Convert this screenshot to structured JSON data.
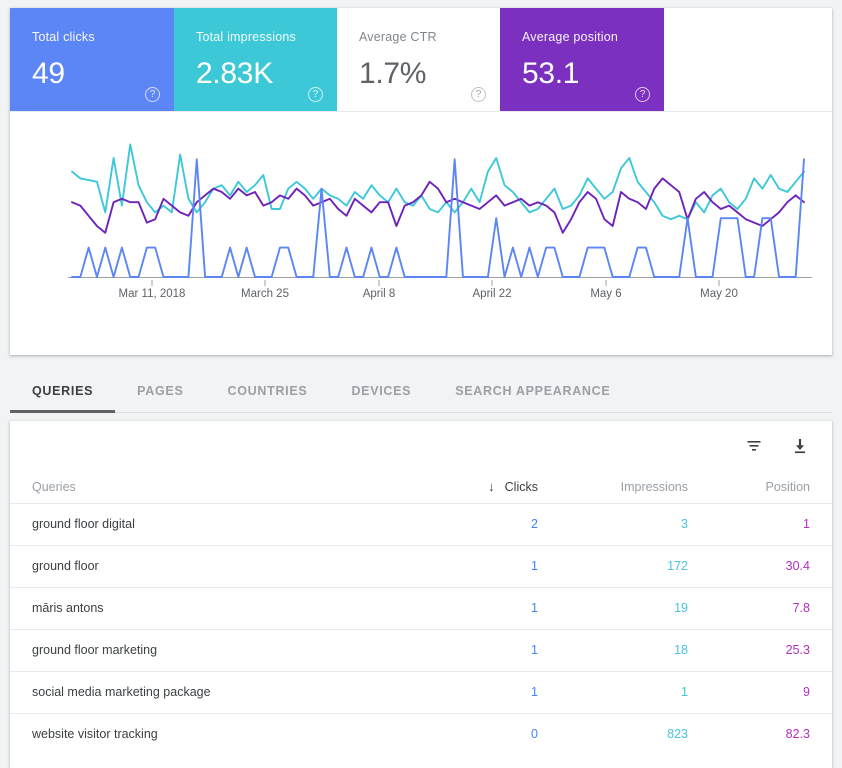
{
  "metrics": [
    {
      "label": "Total clicks",
      "value": "49",
      "key": "clicks",
      "color": "#5c85f5",
      "help": "?"
    },
    {
      "label": "Total impressions",
      "value": "2.83K",
      "key": "impressions",
      "color": "#3dc8d8",
      "help": "?"
    },
    {
      "label": "Average CTR",
      "value": "1.7%",
      "key": "ctr",
      "color": "#ffffff",
      "help": "?"
    },
    {
      "label": "Average position",
      "value": "53.1",
      "key": "position",
      "color": "#7c30c0",
      "help": "?"
    }
  ],
  "chart_data": {
    "type": "line",
    "title": "",
    "xlabel": "",
    "ylabel": "",
    "grid": false,
    "legend": "none",
    "x_tick_labels": [
      "Mar 11, 2018",
      "March 25",
      "April 8",
      "April 22",
      "May 6",
      "May 20"
    ],
    "x_tick_positions": [
      152,
      265,
      379,
      492,
      606,
      719
    ],
    "series": [
      {
        "name": "Clicks",
        "color": "#5c85f5",
        "values": [
          0,
          0,
          1,
          0,
          1,
          0,
          1,
          0,
          0,
          1,
          1,
          0,
          0,
          0,
          0,
          4,
          0,
          0,
          0,
          1,
          0,
          1,
          0,
          0,
          0,
          1,
          1,
          0,
          0,
          0,
          3,
          0,
          0,
          1,
          0,
          0,
          1,
          0,
          0,
          1,
          0,
          0,
          0,
          0,
          0,
          0,
          4,
          0,
          0,
          0,
          0,
          2,
          0,
          1,
          0,
          1,
          0,
          1,
          1,
          0,
          0,
          0,
          1,
          1,
          1,
          0,
          0,
          0,
          1,
          1,
          0,
          0,
          0,
          0,
          2,
          0,
          0,
          0,
          2,
          2,
          2,
          0,
          0,
          2,
          2,
          0,
          0,
          0,
          4
        ]
      },
      {
        "name": "Impressions",
        "color": "#3dc8d8",
        "values": [
          62,
          58,
          57,
          56,
          38,
          70,
          42,
          78,
          54,
          44,
          38,
          42,
          38,
          72,
          46,
          38,
          44,
          52,
          54,
          48,
          56,
          50,
          54,
          60,
          40,
          40,
          52,
          56,
          52,
          46,
          52,
          48,
          46,
          42,
          50,
          46,
          54,
          48,
          44,
          52,
          44,
          42,
          48,
          40,
          38,
          44,
          38,
          44,
          52,
          44,
          62,
          70,
          54,
          50,
          44,
          38,
          40,
          46,
          52,
          40,
          42,
          48,
          58,
          52,
          46,
          50,
          64,
          70,
          56,
          50,
          44,
          36,
          34,
          36,
          34,
          44,
          38,
          48,
          52,
          44,
          40,
          46,
          58,
          52,
          60,
          52,
          50,
          56,
          62
        ]
      },
      {
        "name": "Position",
        "color": "#6f22b8",
        "values": [
          44,
          42,
          36,
          30,
          26,
          44,
          46,
          44,
          44,
          32,
          34,
          46,
          42,
          38,
          36,
          44,
          48,
          52,
          50,
          46,
          52,
          48,
          50,
          42,
          44,
          48,
          46,
          52,
          48,
          42,
          44,
          46,
          40,
          36,
          46,
          42,
          38,
          44,
          44,
          30,
          42,
          44,
          48,
          56,
          52,
          44,
          46,
          44,
          42,
          40,
          44,
          48,
          42,
          44,
          46,
          42,
          44,
          42,
          38,
          26,
          34,
          44,
          50,
          46,
          34,
          30,
          50,
          46,
          44,
          40,
          52,
          58,
          54,
          50,
          34,
          46,
          50,
          44,
          40,
          42,
          38,
          34,
          32,
          30,
          34,
          38,
          44,
          48,
          44
        ]
      }
    ]
  },
  "tabs": [
    {
      "label": "QUERIES",
      "active": true
    },
    {
      "label": "PAGES",
      "active": false
    },
    {
      "label": "COUNTRIES",
      "active": false
    },
    {
      "label": "DEVICES",
      "active": false
    },
    {
      "label": "SEARCH APPEARANCE",
      "active": false
    }
  ],
  "toolbar": {
    "filter_icon": "filter-icon",
    "download_icon": "download-icon"
  },
  "table": {
    "columns": [
      {
        "label": "Queries",
        "sorted": false
      },
      {
        "label": "Clicks",
        "sorted": true,
        "sort_arrow": "↓"
      },
      {
        "label": "Impressions",
        "sorted": false
      },
      {
        "label": "Position",
        "sorted": false
      }
    ],
    "rows": [
      {
        "query": "ground floor digital",
        "clicks": "2",
        "impressions": "3",
        "position": "1"
      },
      {
        "query": "ground floor",
        "clicks": "1",
        "impressions": "172",
        "position": "30.4"
      },
      {
        "query": "māris antons",
        "clicks": "1",
        "impressions": "19",
        "position": "7.8"
      },
      {
        "query": "ground floor marketing",
        "clicks": "1",
        "impressions": "18",
        "position": "25.3"
      },
      {
        "query": "social media marketing package",
        "clicks": "1",
        "impressions": "1",
        "position": "9"
      },
      {
        "query": "website visitor tracking",
        "clicks": "0",
        "impressions": "823",
        "position": "82.3"
      }
    ]
  }
}
